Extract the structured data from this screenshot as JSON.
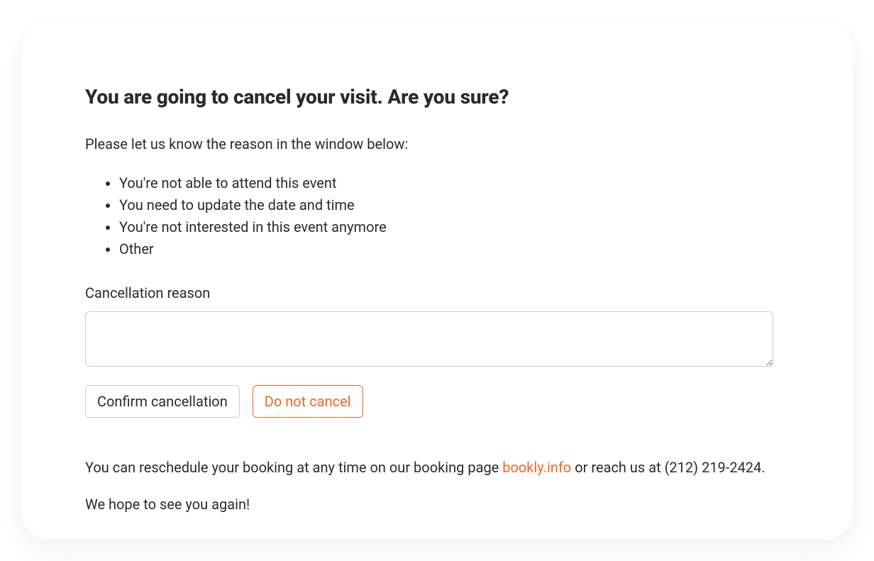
{
  "heading": "You are going to cancel your visit. Are you sure?",
  "intro": "Please let us know the reason in the window below:",
  "reasons": [
    "You're not able to attend this event",
    "You need to update the date and time",
    "You're not interested in this event anymore",
    "Other"
  ],
  "field": {
    "label": "Cancellation reason",
    "value": ""
  },
  "buttons": {
    "confirm": "Confirm cancellation",
    "do_not_cancel": "Do not cancel"
  },
  "footer": {
    "prefix": "You can reschedule your booking at any time on our booking page ",
    "link_text": "bookly.info",
    "suffix": " or reach us at (212) 219-2424."
  },
  "closing": "We hope to see you again!",
  "colors": {
    "accent": "#f26522"
  }
}
